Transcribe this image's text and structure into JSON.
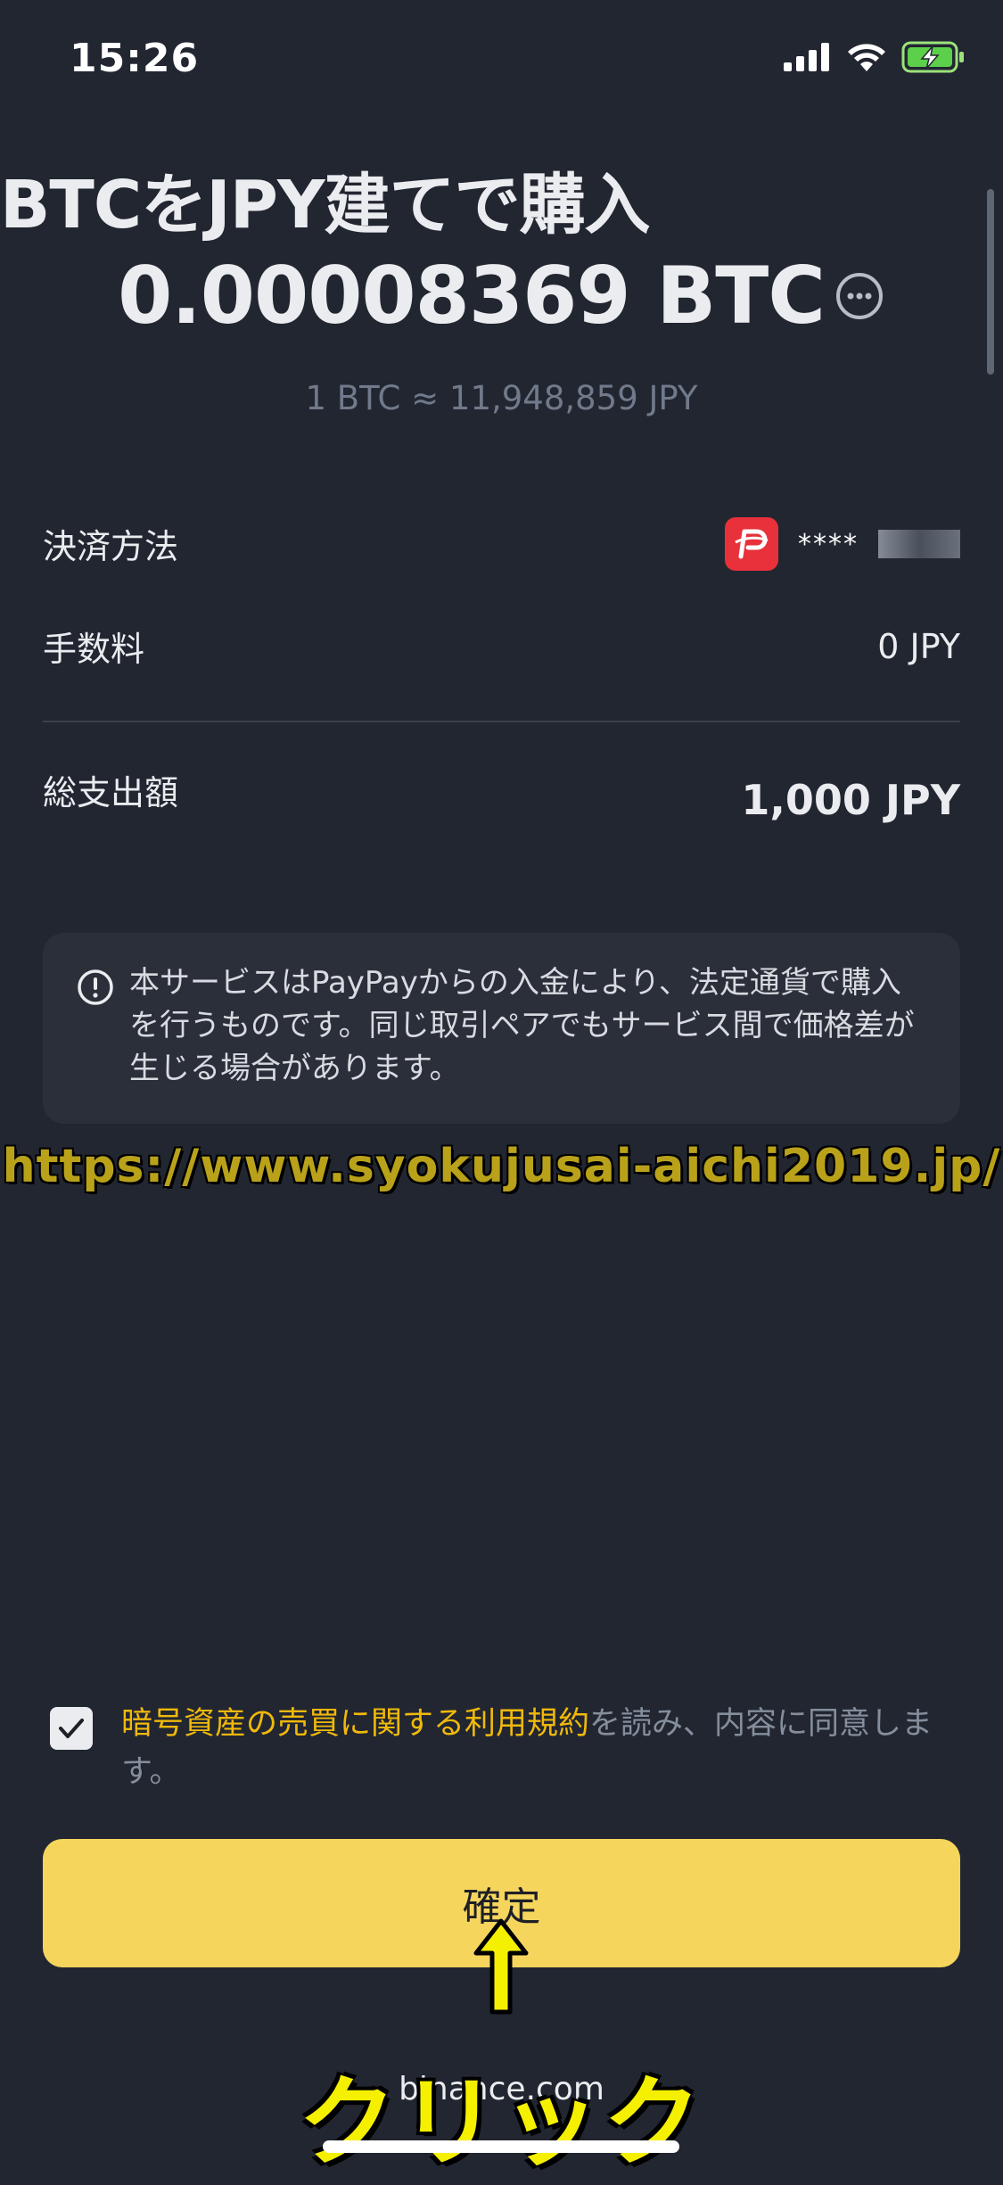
{
  "status_bar": {
    "time": "15:26"
  },
  "header": {
    "title": "BTCをJPY建てで購入",
    "amount": "0.00008369 BTC",
    "rate": "1 BTC ≈ 11,948,859 JPY"
  },
  "details": {
    "payment_method_label": "決済方法",
    "payment_method_value": "****",
    "fee_label": "手数料",
    "fee_value": "0 JPY",
    "total_label": "総支出額",
    "total_value": "1,000 JPY"
  },
  "notice": {
    "text": "本サービスはPayPayからの入金により、法定通貨で購入を行うものです。同じ取引ペアでもサービス間で価格差が生じる場合があります。"
  },
  "watermark": {
    "url": "https://www.syokujusai-aichi2019.jp/"
  },
  "agreement": {
    "checked": true,
    "link_text": "暗号資産の売買に関する利用規約",
    "rest_text": "を読み、内容に同意します。"
  },
  "confirm": {
    "label": "確定"
  },
  "annotation": {
    "click_label": "クリック"
  },
  "footer": {
    "domain": "binance.com"
  },
  "colors": {
    "background": "#222631",
    "accent": "#f6d55d",
    "link": "#f0b90b",
    "paypay": "#e8313a"
  },
  "icons": [
    "signal-icon",
    "wifi-icon",
    "battery-charging-icon",
    "more-icon",
    "paypay-logo",
    "info-icon",
    "check-icon",
    "arrow-up-icon"
  ]
}
